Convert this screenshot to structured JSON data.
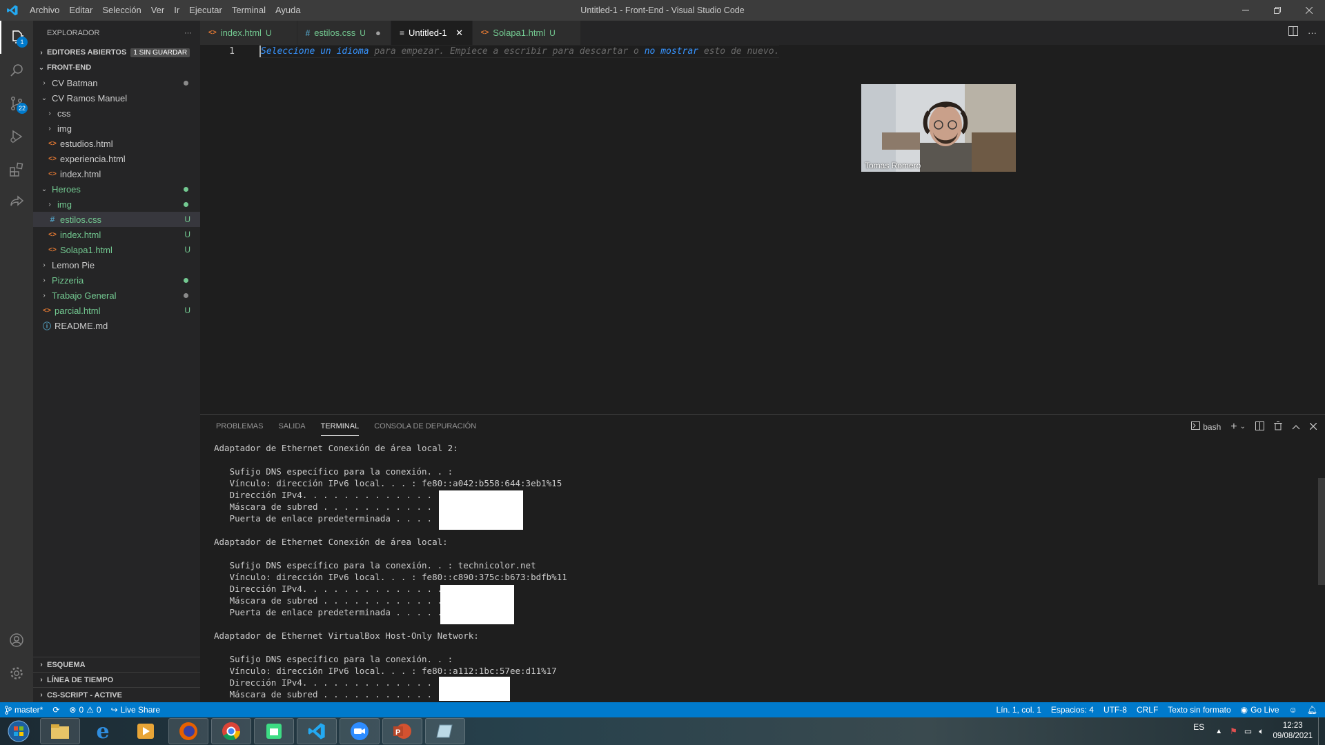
{
  "window": {
    "title": "Untitled-1 - Front-End - Visual Studio Code",
    "menu": [
      "Archivo",
      "Editar",
      "Selección",
      "Ver",
      "Ir",
      "Ejecutar",
      "Terminal",
      "Ayuda"
    ]
  },
  "activity": {
    "scm_badge": "22",
    "explorer_badge": "1"
  },
  "sidebar": {
    "header": "EXPLORADOR",
    "more": "···",
    "open_editors": "EDITORES ABIERTOS",
    "unsaved_pill": "1 SIN GUARDAR",
    "folder": "FRONT-END",
    "tree": [
      {
        "name": "CV Batman",
        "chev": "›",
        "icon": "",
        "deco": "",
        "dot": "#8a8a8a",
        "color": "c-white",
        "indent": 0
      },
      {
        "name": "CV Ramos Manuel",
        "chev": "⌄",
        "icon": "",
        "deco": "",
        "dot": "",
        "color": "c-white",
        "indent": 0
      },
      {
        "name": "css",
        "chev": "›",
        "icon": "",
        "deco": "",
        "dot": "",
        "color": "c-white",
        "indent": 1
      },
      {
        "name": "img",
        "chev": "›",
        "icon": "",
        "deco": "",
        "dot": "",
        "color": "c-white",
        "indent": 1
      },
      {
        "name": "estudios.html",
        "chev": "",
        "icon": "<>",
        "deco": "",
        "dot": "",
        "color": "c-white",
        "indent": 1
      },
      {
        "name": "experiencia.html",
        "chev": "",
        "icon": "<>",
        "deco": "",
        "dot": "",
        "color": "c-white",
        "indent": 1
      },
      {
        "name": "index.html",
        "chev": "",
        "icon": "<>",
        "deco": "",
        "dot": "",
        "color": "c-white",
        "indent": 1
      },
      {
        "name": "Heroes",
        "chev": "⌄",
        "icon": "",
        "deco": "",
        "dot": "#73c991",
        "color": "c-green",
        "indent": 0
      },
      {
        "name": "img",
        "chev": "›",
        "icon": "",
        "deco": "",
        "dot": "#73c991",
        "color": "c-green",
        "indent": 1
      },
      {
        "name": "estilos.css",
        "chev": "",
        "icon": "#",
        "deco": "U",
        "dot": "",
        "color": "c-green",
        "indent": 1,
        "selected": true
      },
      {
        "name": "index.html",
        "chev": "",
        "icon": "<>",
        "deco": "U",
        "dot": "",
        "color": "c-green",
        "indent": 1
      },
      {
        "name": "Solapa1.html",
        "chev": "",
        "icon": "<>",
        "deco": "U",
        "dot": "",
        "color": "c-green",
        "indent": 1
      },
      {
        "name": "Lemon Pie",
        "chev": "›",
        "icon": "",
        "deco": "",
        "dot": "",
        "color": "c-white",
        "indent": 0
      },
      {
        "name": "Pizzeria",
        "chev": "›",
        "icon": "",
        "deco": "",
        "dot": "#73c991",
        "color": "c-green",
        "indent": 0
      },
      {
        "name": "Trabajo General",
        "chev": "›",
        "icon": "",
        "deco": "",
        "dot": "#8a8a8a",
        "color": "c-green",
        "indent": 0
      },
      {
        "name": "parcial.html",
        "chev": "",
        "icon": "<>",
        "deco": "U",
        "dot": "",
        "color": "c-green",
        "indent": 0
      },
      {
        "name": "README.md",
        "chev": "",
        "icon": "ⓘ",
        "deco": "",
        "dot": "",
        "color": "c-white",
        "indent": 0
      }
    ],
    "bottom_sections": [
      "ESQUEMA",
      "LÍNEA DE TIEMPO",
      "CS-SCRIPT - ACTIVE"
    ]
  },
  "tabs": [
    {
      "label": "index.html",
      "icon": "<>",
      "icon_color": "#e37933",
      "status": "U",
      "active": false
    },
    {
      "label": "estilos.css",
      "icon": "#",
      "icon_color": "#519aba",
      "status": "U",
      "active": false,
      "dirty": "●"
    },
    {
      "label": "Untitled-1",
      "icon": "≡",
      "icon_color": "#cccccc",
      "status": "",
      "active": true,
      "close": "✕"
    },
    {
      "label": "Solapa1.html",
      "icon": "<>",
      "icon_color": "#e37933",
      "status": "U",
      "active": false
    }
  ],
  "editor": {
    "line_number": "1",
    "hint_part1": "Seleccione un idioma",
    "hint_part2": " para empezar. Empiece a escribir para descartar o ",
    "hint_part3": "no mostrar",
    "hint_part4": " esto de nuevo."
  },
  "video": {
    "participant": "Tomas Romero"
  },
  "panel": {
    "tabs": [
      "PROBLEMAS",
      "SALIDA",
      "TERMINAL",
      "CONSOLA DE DEPURACIÓN"
    ],
    "active_tab": "TERMINAL",
    "shell": "bash",
    "terminal_lines": [
      "Adaptador de Ethernet Conexión de área local 2:",
      "",
      "   Sufijo DNS específico para la conexión. . :",
      "   Vínculo: dirección IPv6 local. . . : fe80::a042:b558:644:3eb1%15",
      "   Dirección IPv4. . . . . . . . . . . . . . :",
      "   Máscara de subred . . . . . . . . . . . . :",
      "   Puerta de enlace predeterminada . . . . . :",
      "",
      "Adaptador de Ethernet Conexión de área local:",
      "",
      "   Sufijo DNS específico para la conexión. . : technicolor.net",
      "   Vínculo: dirección IPv6 local. . . : fe80::c890:375c:b673:bdfb%11",
      "   Dirección IPv4. . . . . . . . . . . . . . :",
      "   Máscara de subred . . . . . . . . . . . . :",
      "   Puerta de enlace predeterminada . . . . . :",
      "",
      "Adaptador de Ethernet VirtualBox Host-Only Network:",
      "",
      "   Sufijo DNS específico para la conexión. . :",
      "   Vínculo: dirección IPv6 local. . . : fe80::a112:1bc:57ee:d11%17",
      "   Dirección IPv4. . . . . . . . . . . . . . :",
      "   Máscara de subred . . . . . . . . . . . . :"
    ]
  },
  "statusbar": {
    "branch": "master*",
    "errors": "0",
    "warnings": "0",
    "live_share": "Live Share",
    "position": "Lín. 1, col. 1",
    "spaces": "Espacios: 4",
    "encoding": "UTF-8",
    "eol": "CRLF",
    "language": "Texto sin formato",
    "go_live": "Go Live"
  },
  "taskbar": {
    "lang": "ES",
    "time": "12:23",
    "date": "09/08/2021"
  },
  "colors": {
    "accent": "#007acc",
    "git_untracked": "#73c991"
  }
}
